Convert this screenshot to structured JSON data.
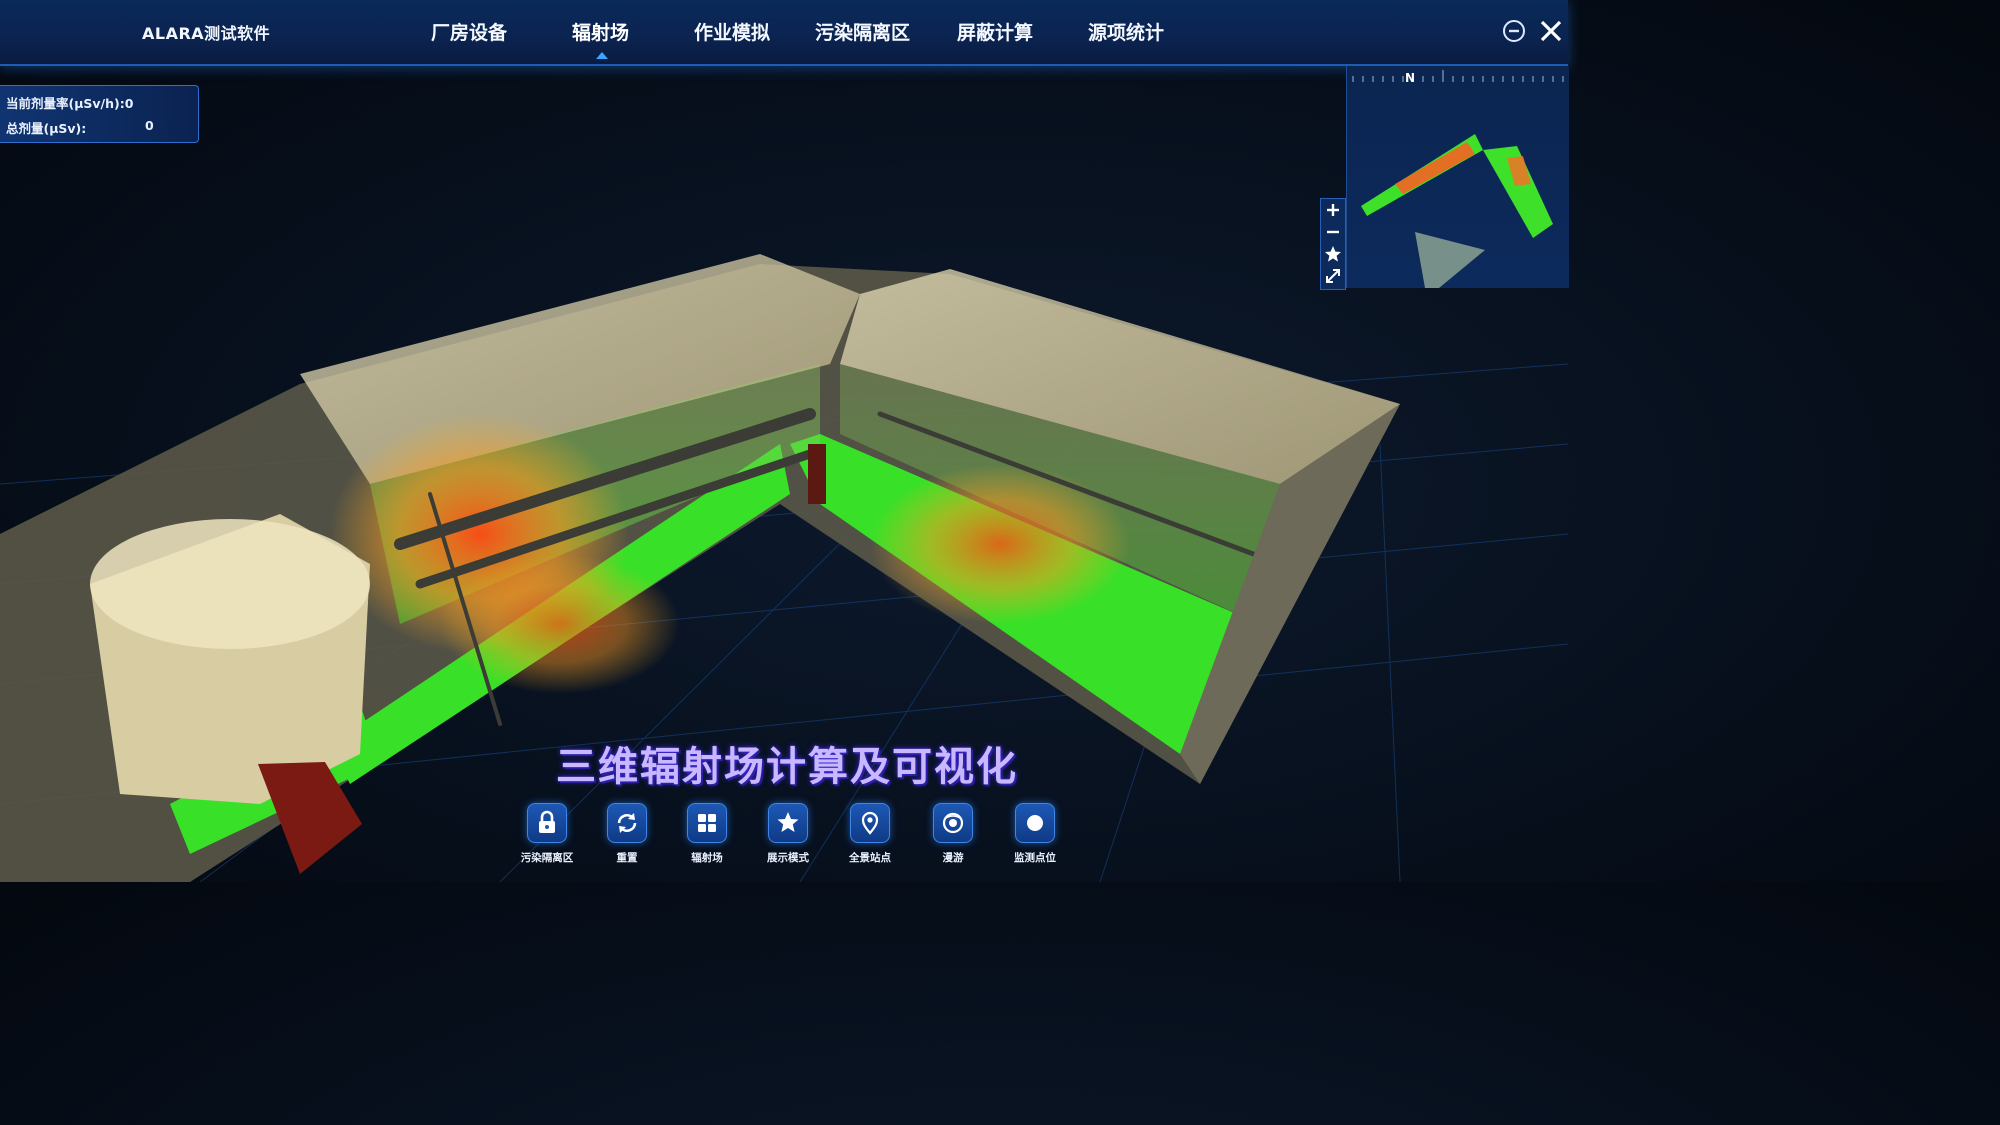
{
  "app": {
    "title": "ALARA测试软件"
  },
  "nav": {
    "items": [
      {
        "label": "厂房设备"
      },
      {
        "label": "辐射场"
      },
      {
        "label": "作业模拟"
      },
      {
        "label": "污染隔离区"
      },
      {
        "label": "屏蔽计算"
      },
      {
        "label": "源项统计"
      }
    ],
    "active_index": 1
  },
  "dose": {
    "rate_label": "当前剂量率(μSv/h):0",
    "total_label": "总剂量(μSv):",
    "total_value": "0"
  },
  "minimap": {
    "north_label": "N"
  },
  "caption": "三维辐射场计算及可视化",
  "toolbar": {
    "items": [
      {
        "label": "污染隔离区",
        "icon": "lock-icon"
      },
      {
        "label": "重置",
        "icon": "refresh-icon"
      },
      {
        "label": "辐射场",
        "icon": "grid-icon"
      },
      {
        "label": "展示模式",
        "icon": "star-icon"
      },
      {
        "label": "全景站点",
        "icon": "location-pin-icon"
      },
      {
        "label": "漫游",
        "icon": "roam-icon"
      },
      {
        "label": "监测点位",
        "icon": "dot-icon"
      }
    ]
  },
  "colors": {
    "accent": "#1d5cb3",
    "floor_low": "#39e22a",
    "floor_high": "#ff5a1a",
    "wall": "#d9cfa8"
  }
}
